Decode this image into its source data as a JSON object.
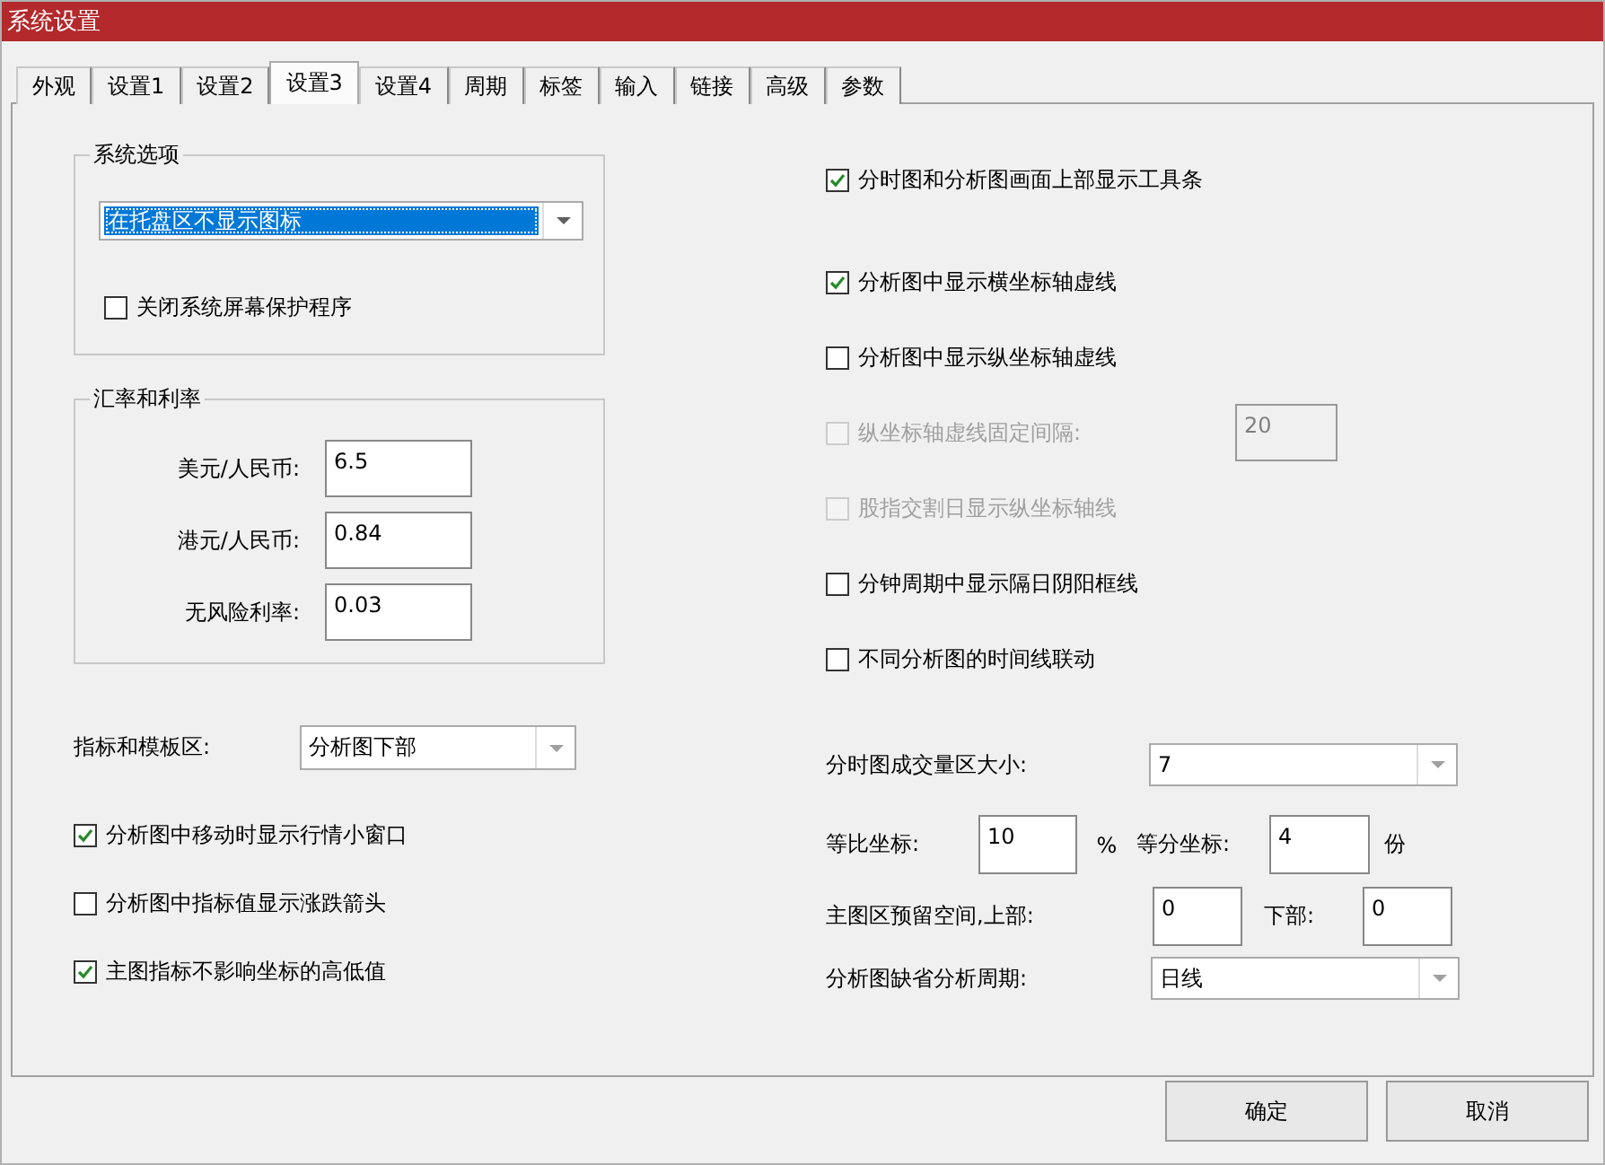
{
  "window": {
    "title": "系统设置"
  },
  "tabs": [
    {
      "label": "外观",
      "selected": false
    },
    {
      "label": "设置1",
      "selected": false
    },
    {
      "label": "设置2",
      "selected": false
    },
    {
      "label": "设置3",
      "selected": true
    },
    {
      "label": "设置4",
      "selected": false
    },
    {
      "label": "周期",
      "selected": false
    },
    {
      "label": "标签",
      "selected": false
    },
    {
      "label": "输入",
      "selected": false
    },
    {
      "label": "链接",
      "selected": false
    },
    {
      "label": "高级",
      "selected": false
    },
    {
      "label": "参数",
      "selected": false
    }
  ],
  "system_options": {
    "title": "系统选项",
    "dropdown": {
      "value": "在托盘区不显示图标",
      "focused": true
    },
    "checkbox": {
      "label": "关闭系统屏幕保护程序",
      "checked": false
    }
  },
  "rates": {
    "title": "汇率和利率",
    "fields": [
      {
        "label": "美元/人民币:",
        "value": "6.5"
      },
      {
        "label": "港元/人民币:",
        "value": "0.84"
      },
      {
        "label": "无风险利率:",
        "value": "0.03"
      }
    ]
  },
  "right_options": [
    {
      "label": "分时图和分析图画面上部显示工具条",
      "checked": true,
      "disabled": false
    },
    {
      "label": "分析图中显示横坐标轴虚线",
      "checked": true,
      "disabled": false
    },
    {
      "label": "分析图中显示纵坐标轴虚线",
      "checked": false,
      "disabled": false
    },
    {
      "label": "纵坐标轴虚线固定间隔:",
      "checked": false,
      "disabled": true,
      "value": "20"
    },
    {
      "label": "股指交割日显示纵坐标轴线",
      "checked": false,
      "disabled": true
    },
    {
      "label": "分钟周期中显示隔日阴阳框线",
      "checked": false,
      "disabled": false
    },
    {
      "label": "不同分析图的时间线联动",
      "checked": false,
      "disabled": false
    }
  ],
  "indicator_area": {
    "label": "指标和模板区:",
    "value": "分析图下部"
  },
  "left_options": [
    {
      "label": "分析图中移动时显示行情小窗口",
      "checked": true
    },
    {
      "label": "分析图中指标值显示涨跌箭头",
      "checked": false
    },
    {
      "label": "主图指标不影响坐标的高低值",
      "checked": true
    }
  ],
  "volume_area": {
    "label": "分时图成交量区大小:",
    "value": "7"
  },
  "scale_row": {
    "ratio_label": "等比坐标:",
    "ratio_value": "10",
    "ratio_unit": "%",
    "equal_label": "等分坐标:",
    "equal_value": "4",
    "equal_unit": "份"
  },
  "reserve_row": {
    "label": "主图区预留空间,上部:",
    "top_value": "0",
    "bottom_label": "下部:",
    "bottom_value": "0"
  },
  "period": {
    "label": "分析图缺省分析周期:",
    "value": "日线"
  },
  "buttons": [
    "确定",
    "取消"
  ]
}
